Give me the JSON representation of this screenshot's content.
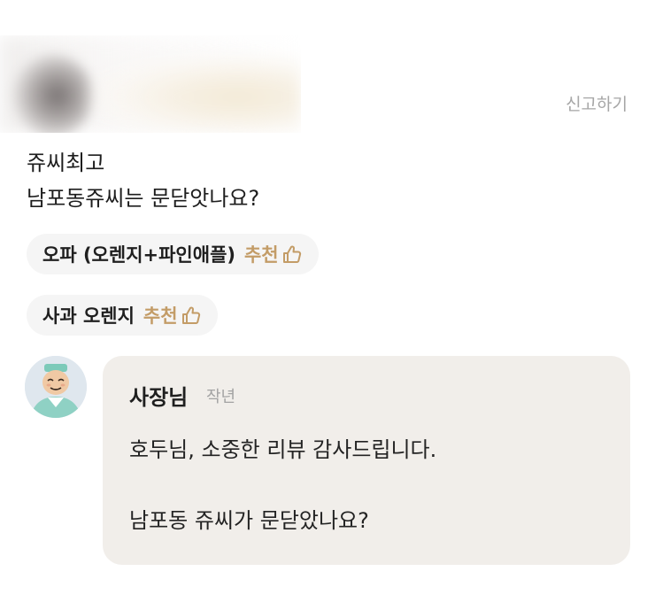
{
  "report_label": "신고하기",
  "review": {
    "lines": [
      "쥬씨최고",
      "남포동쥬씨는 문닫앗나요?"
    ]
  },
  "tags": [
    {
      "name": "오파 (오렌지+파인애플)",
      "recommend": "추천"
    },
    {
      "name": "사과 오렌지",
      "recommend": "추천"
    }
  ],
  "reply": {
    "author": "사장님",
    "time": "작년",
    "lines": [
      "호두님, 소중한 리뷰 감사드립니다.",
      "남포동 쥬씨가 문닫았나요?"
    ]
  },
  "colors": {
    "accent": "#c39c67",
    "bubble": "#f1eeea",
    "tag_bg": "#f5f5f5",
    "muted": "#a6a6a6"
  },
  "icons": {
    "thumb": "thumbs-up-icon"
  }
}
